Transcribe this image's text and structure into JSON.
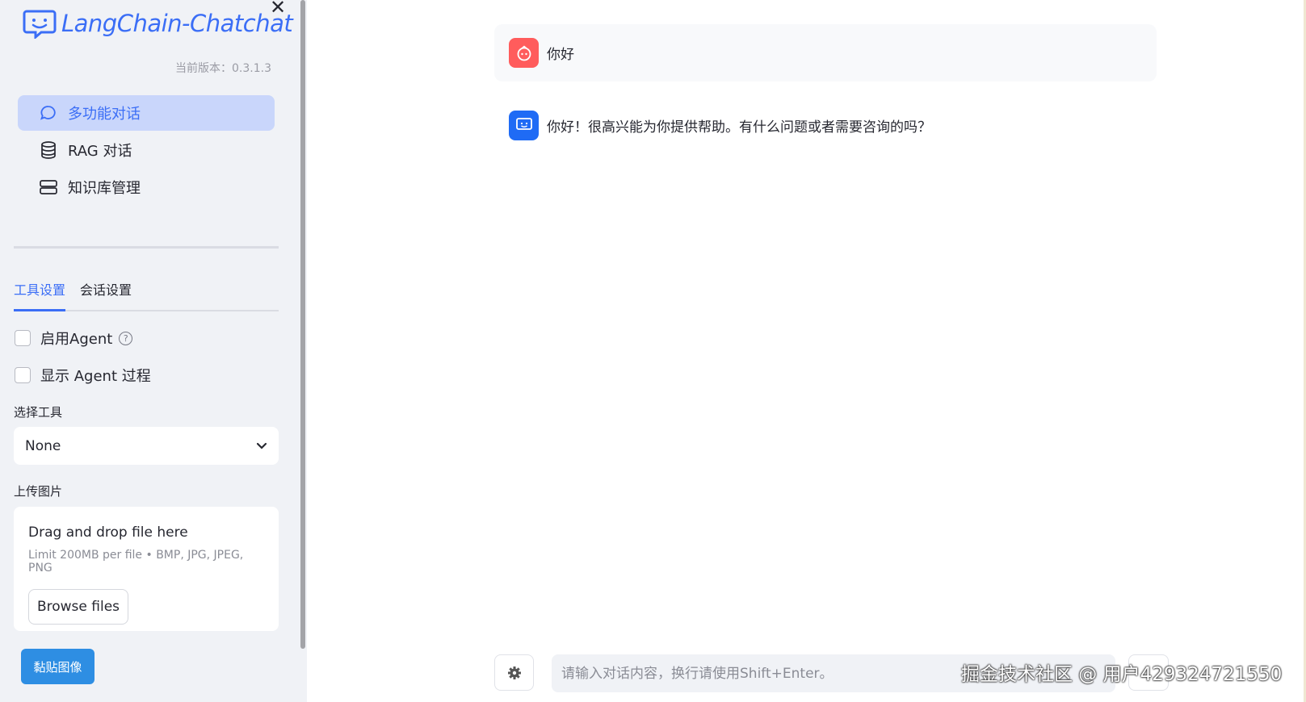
{
  "app": {
    "logo_text": "LangChain-Chatchat",
    "version_label": "当前版本：0.3.1.3",
    "close_glyph": "✕"
  },
  "sidebar": {
    "menu": [
      {
        "label": "多功能对话",
        "icon": "chat-bubble-icon",
        "active": true
      },
      {
        "label": "RAG 对话",
        "icon": "database-icon",
        "active": false
      },
      {
        "label": "知识库管理",
        "icon": "storage-icon",
        "active": false
      }
    ],
    "tabs": [
      {
        "label": "工具设置",
        "active": true
      },
      {
        "label": "会话设置",
        "active": false
      }
    ],
    "enable_agent_label": "启用Agent",
    "help_glyph": "?",
    "show_agent_process_label": "显示 Agent 过程",
    "select_tool_label": "选择工具",
    "select_tool_value": "None",
    "upload_image_label": "上传图片",
    "upload": {
      "title": "Drag and drop file here",
      "limit": "Limit 200MB per file • BMP, JPG, JPEG, PNG",
      "browse_label": "Browse files"
    },
    "paste_image_label": "黏贴图像"
  },
  "chat": {
    "messages": [
      {
        "role": "user",
        "text": "你好"
      },
      {
        "role": "assistant",
        "text": "你好！很高兴能为你提供帮助。有什么问题或者需要咨询的吗？"
      }
    ],
    "input_placeholder": "请输入对话内容，换行请使用Shift+Enter。"
  },
  "watermark": "掘金技术社区 @ 用户429324721550",
  "colors": {
    "accent": "#3b6ef6",
    "sidebar_bg": "#f0f2f6",
    "active_menu_bg": "#c9d6fb",
    "paste_button": "#2e8ee3",
    "user_avatar": "#ff5c5c",
    "ai_avatar": "#1f6bf5"
  }
}
